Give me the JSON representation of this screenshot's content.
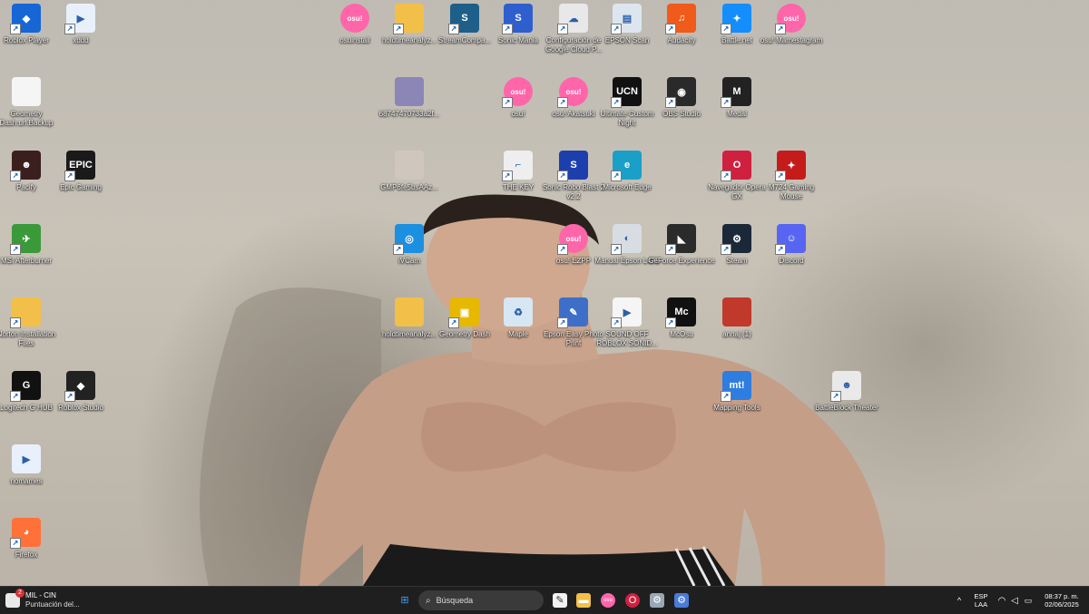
{
  "desktop": {
    "icons": [
      {
        "label": "Roblox Player",
        "icon": "roblox-icon",
        "color": "#1666d6",
        "glyph": "◆",
        "shortcut": true
      },
      {
        "label": "xddd",
        "icon": "document-icon",
        "color": "#e8f0fb",
        "glyph": "▶",
        "shortcut": true
      },
      {
        "label": "osuinstall",
        "icon": "osu-icon",
        "color": "#ff66aa",
        "glyph": "osu!",
        "shortcut": false
      },
      {
        "label": "holdtimeanalyz...",
        "icon": "folder-icon",
        "color": "#f2c048",
        "glyph": "",
        "shortcut": true
      },
      {
        "label": "StreamCompa...",
        "icon": "streamcompanion-icon",
        "color": "#1e5f8a",
        "glyph": "S",
        "shortcut": true
      },
      {
        "label": "Sonic Mania",
        "icon": "sonic-icon",
        "color": "#2f5fcf",
        "glyph": "S",
        "shortcut": true
      },
      {
        "label": "Configuración de Google Cloud P...",
        "icon": "printer-cloud-icon",
        "color": "#e8e8e8",
        "glyph": "☁",
        "shortcut": true
      },
      {
        "label": "EPSON Scan",
        "icon": "scanner-icon",
        "color": "#dde6ee",
        "glyph": "▤",
        "shortcut": true
      },
      {
        "label": "Audacity",
        "icon": "audacity-icon",
        "color": "#f05a1a",
        "glyph": "♫",
        "shortcut": true
      },
      {
        "label": "Battle.net",
        "icon": "battlenet-icon",
        "color": "#148eff",
        "glyph": "✦",
        "shortcut": true
      },
      {
        "label": "osu! Mamestagram",
        "icon": "osu-icon",
        "color": "#ff66aa",
        "glyph": "osu!",
        "shortcut": true
      },
      {
        "label": "Geometry Dash.url.Backup",
        "icon": "file-icon",
        "color": "#f5f5f5",
        "glyph": "",
        "shortcut": false
      },
      {
        "label": "68747470733a2f...",
        "icon": "image-icon",
        "color": "#8b86b6",
        "glyph": "",
        "shortcut": false
      },
      {
        "label": "osu!",
        "icon": "osu-icon",
        "color": "#ff66aa",
        "glyph": "osu!",
        "shortcut": true
      },
      {
        "label": "osu! Akatsuki",
        "icon": "osu-icon",
        "color": "#ff66aa",
        "glyph": "osu!",
        "shortcut": true
      },
      {
        "label": "Ultimate Custom Night",
        "icon": "ucn-icon",
        "color": "#111111",
        "glyph": "UCN",
        "shortcut": true
      },
      {
        "label": "OBS Studio",
        "icon": "obs-icon",
        "color": "#2a2a2a",
        "glyph": "◉",
        "shortcut": true
      },
      {
        "label": "Medal",
        "icon": "medal-icon",
        "color": "#222222",
        "glyph": "M",
        "shortcut": true
      },
      {
        "label": "Pacify",
        "icon": "pacify-icon",
        "color": "#3b1f1f",
        "glyph": "☻",
        "shortcut": true
      },
      {
        "label": "Epic Gaming",
        "icon": "epic-games-icon",
        "color": "#1a1a1a",
        "glyph": "EPIC",
        "shortcut": true
      },
      {
        "label": "GMP6fe5bsAAz...",
        "icon": "image-icon",
        "color": "#cfc7be",
        "glyph": "",
        "shortcut": false
      },
      {
        "label": "THE KEY",
        "icon": "thekey-icon",
        "color": "#eeeeee",
        "glyph": "⌐",
        "shortcut": true
      },
      {
        "label": "Sonic Robo Blast 2 v2.2",
        "icon": "srb2-icon",
        "color": "#1d3fae",
        "glyph": "S",
        "shortcut": true
      },
      {
        "label": "Microsoft Edge",
        "icon": "edge-icon",
        "color": "#1aa0c8",
        "glyph": "e",
        "shortcut": true
      },
      {
        "label": "Navegador Opera GX",
        "icon": "opera-gx-icon",
        "color": "#d02040",
        "glyph": "O",
        "shortcut": true
      },
      {
        "label": "M724 Gaming Mouse",
        "icon": "mouse-dragon-icon",
        "color": "#c61b1b",
        "glyph": "✦",
        "shortcut": true
      },
      {
        "label": "MSI Afterburner",
        "icon": "afterburner-icon",
        "color": "#3a9a3a",
        "glyph": "✈",
        "shortcut": true
      },
      {
        "label": "iVCam",
        "icon": "ivcam-icon",
        "color": "#1d8fe0",
        "glyph": "◎",
        "shortcut": true
      },
      {
        "label": "osu! EZPP",
        "icon": "osu-icon",
        "color": "#ff66aa",
        "glyph": "osu!",
        "shortcut": true
      },
      {
        "label": "Manual Epson L475",
        "icon": "manual-icon",
        "color": "#d8dde3",
        "glyph": "◐",
        "shortcut": true
      },
      {
        "label": "GeForce Experience",
        "icon": "geforce-icon",
        "color": "#2b2b2b",
        "glyph": "◣",
        "shortcut": true
      },
      {
        "label": "Steam",
        "icon": "steam-icon",
        "color": "#1b2838",
        "glyph": "⚙",
        "shortcut": true
      },
      {
        "label": "Discord",
        "icon": "discord-icon",
        "color": "#5865f2",
        "glyph": "☺",
        "shortcut": true
      },
      {
        "label": "Norton Installation Files",
        "icon": "folder-icon",
        "color": "#f2c048",
        "glyph": "",
        "shortcut": true
      },
      {
        "label": "holdtimeanalyz...",
        "icon": "folder-icon",
        "color": "#f2c048",
        "glyph": "",
        "shortcut": false
      },
      {
        "label": "Geometry Dash",
        "icon": "geometry-dash-icon",
        "color": "#e6b900",
        "glyph": "▣",
        "shortcut": true
      },
      {
        "label": "Maple",
        "icon": "recycle-bin-icon",
        "color": "#d6e6f2",
        "glyph": "♻",
        "shortcut": false
      },
      {
        "label": "Epson Easy Photo Print",
        "icon": "epson-photo-icon",
        "color": "#3e6fc8",
        "glyph": "✎",
        "shortcut": true
      },
      {
        "label": "SOUND OFF ROBLOX SONID...",
        "icon": "media-file-icon",
        "color": "#f5f5f5",
        "glyph": "▶",
        "shortcut": true
      },
      {
        "label": "McOsu",
        "icon": "mcosu-icon",
        "color": "#111111",
        "glyph": "Mc",
        "shortcut": true
      },
      {
        "label": "annaj (1)",
        "icon": "image-icon",
        "color": "#c0392b",
        "glyph": "",
        "shortcut": false
      },
      {
        "label": "Logitech G HUB",
        "icon": "logitech-icon",
        "color": "#111111",
        "glyph": "G",
        "shortcut": true
      },
      {
        "label": "Roblox Studio",
        "icon": "roblox-studio-icon",
        "color": "#222222",
        "glyph": "◆",
        "shortcut": true
      },
      {
        "label": "Mapping Tools",
        "icon": "mapping-tools-icon",
        "color": "#2e7de0",
        "glyph": "mt!",
        "shortcut": true
      },
      {
        "label": "BattleBlock Theater",
        "icon": "battleblock-icon",
        "color": "#e9e9e9",
        "glyph": "☻",
        "shortcut": true
      },
      {
        "label": "nomames",
        "icon": "document-icon",
        "color": "#e8f0fb",
        "glyph": "▶",
        "shortcut": false
      },
      {
        "label": "Firefox",
        "icon": "firefox-icon",
        "color": "#ff7139",
        "glyph": "◕",
        "shortcut": true
      }
    ]
  },
  "taskbar": {
    "notification": {
      "badge": "2",
      "title": "MIL - CIN",
      "subtitle": "Puntuación del..."
    },
    "search_placeholder": "Búsqueda",
    "pinned": [
      {
        "name": "start-button",
        "icon": "windows-icon",
        "color": "#3da0f5",
        "glyph": "⊞"
      },
      {
        "name": "taskbar-whiteboard",
        "icon": "whiteboard-icon",
        "color": "#f2f2f2",
        "glyph": "✎"
      },
      {
        "name": "taskbar-file-explorer",
        "icon": "folder-icon",
        "color": "#f2c048",
        "glyph": "▬"
      },
      {
        "name": "taskbar-osu",
        "icon": "osu-icon",
        "color": "#ff66aa",
        "glyph": "osu"
      },
      {
        "name": "taskbar-opera-gx",
        "icon": "opera-gx-icon",
        "color": "#d02040",
        "glyph": "O"
      },
      {
        "name": "taskbar-settings",
        "icon": "gear-icon",
        "color": "#9aa7b4",
        "glyph": "⚙"
      },
      {
        "name": "taskbar-steam",
        "icon": "steam-icon",
        "color": "#4b7bd8",
        "glyph": "⚙"
      }
    ],
    "tray": {
      "chevron": "^",
      "lang": "ESP",
      "layout": "LAA",
      "time": "08:37 p. m.",
      "date": "02/06/2025"
    }
  }
}
